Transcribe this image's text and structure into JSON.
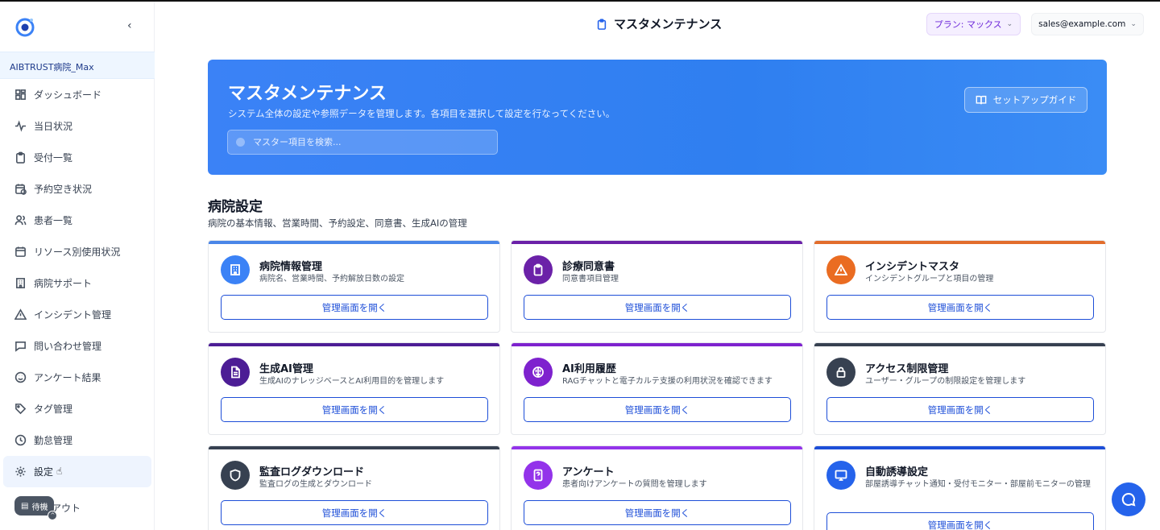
{
  "sidebar": {
    "hospital_name": "AIBTRUST病院_Max",
    "collapse_icon": "chevron-left-icon",
    "items": [
      {
        "label": "ダッシュボード",
        "icon": "grid-icon"
      },
      {
        "label": "当日状況",
        "icon": "activity-icon"
      },
      {
        "label": "受付一覧",
        "icon": "clipboard-icon"
      },
      {
        "label": "予約空き状況",
        "icon": "calendar-clock-icon"
      },
      {
        "label": "患者一覧",
        "icon": "users-icon"
      },
      {
        "label": "リソース別使用状況",
        "icon": "calendar-icon"
      },
      {
        "label": "病院サポート",
        "icon": "building-icon"
      },
      {
        "label": "インシデント管理",
        "icon": "alert-triangle-icon"
      },
      {
        "label": "問い合わせ管理",
        "icon": "message-square-icon"
      },
      {
        "label": "アンケート結果",
        "icon": "smile-icon"
      },
      {
        "label": "タグ管理",
        "icon": "tag-icon"
      },
      {
        "label": "勤怠管理",
        "icon": "clock-icon"
      },
      {
        "label": "設定",
        "icon": "gear-icon",
        "active": true
      }
    ],
    "logout_label": "アウト",
    "wait_label": "待機"
  },
  "header": {
    "title": "マスタメンテナンス",
    "plan_label": "プラン: マックス",
    "user_email": "sales@example.com"
  },
  "hero": {
    "title": "マスタメンテナンス",
    "subtitle": "システム全体の設定や参照データを管理します。各項目を選択して設定を行なってください。",
    "search_placeholder": "マスター項目を検索...",
    "guide_button": "セットアップガイド"
  },
  "section": {
    "title": "病院設定",
    "subtitle": "病院の基本情報、営業時間、予約設定、同意書、生成AIの管理"
  },
  "cards": [
    {
      "title": "病院情報管理",
      "desc": "病院名、営業時間、予約解放日数の設定",
      "button": "管理画面を開く",
      "bar_color": "#4a86e8",
      "icon_color": "#3b82f6",
      "icon": "building-icon"
    },
    {
      "title": "診療同意書",
      "desc": "同意書項目管理",
      "button": "管理画面を開く",
      "bar_color": "#6b21a8",
      "icon_color": "#6b21a8",
      "icon": "clipboard-icon"
    },
    {
      "title": "インシデントマスタ",
      "desc": "インシデントグループと項目の管理",
      "button": "管理画面を開く",
      "bar_color": "#e26d2c",
      "icon_color": "#ea6c22",
      "icon": "alert-triangle-icon"
    },
    {
      "title": "生成AI管理",
      "desc": "生成AIのナレッジベースとAI利用目的を管理します",
      "button": "管理画面を開く",
      "bar_color": "#4c1d95",
      "icon_color": "#4c1d95",
      "icon": "file-text-icon"
    },
    {
      "title": "AI利用履歴",
      "desc": "RAGチャットと電子カルテ支援の利用状況を確認できます",
      "button": "管理画面を開く",
      "bar_color": "#7e22ce",
      "icon_color": "#7e22ce",
      "icon": "brain-icon"
    },
    {
      "title": "アクセス制限管理",
      "desc": "ユーザー・グループの制限設定を管理します",
      "button": "管理画面を開く",
      "bar_color": "#374151",
      "icon_color": "#374151",
      "icon": "lock-icon"
    },
    {
      "title": "監査ログダウンロード",
      "desc": "監査ログの生成とダウンロード",
      "button": "管理画面を開く",
      "bar_color": "#374151",
      "icon_color": "#374151",
      "icon": "shield-icon"
    },
    {
      "title": "アンケート",
      "desc": "患者向けアンケートの質問を管理します",
      "button": "管理画面を開く",
      "bar_color": "#9333ea",
      "icon_color": "#9333ea",
      "icon": "question-file-icon"
    },
    {
      "title": "自動誘導設定",
      "desc": "部屋誘導チャット通知・受付モニター・部屋前モニターの管理",
      "button": "管理画面を開く",
      "bar_color": "#1d4ed8",
      "icon_color": "#2563eb",
      "icon": "monitor-icon"
    }
  ],
  "fab_icon": "chat-bubble-icon"
}
